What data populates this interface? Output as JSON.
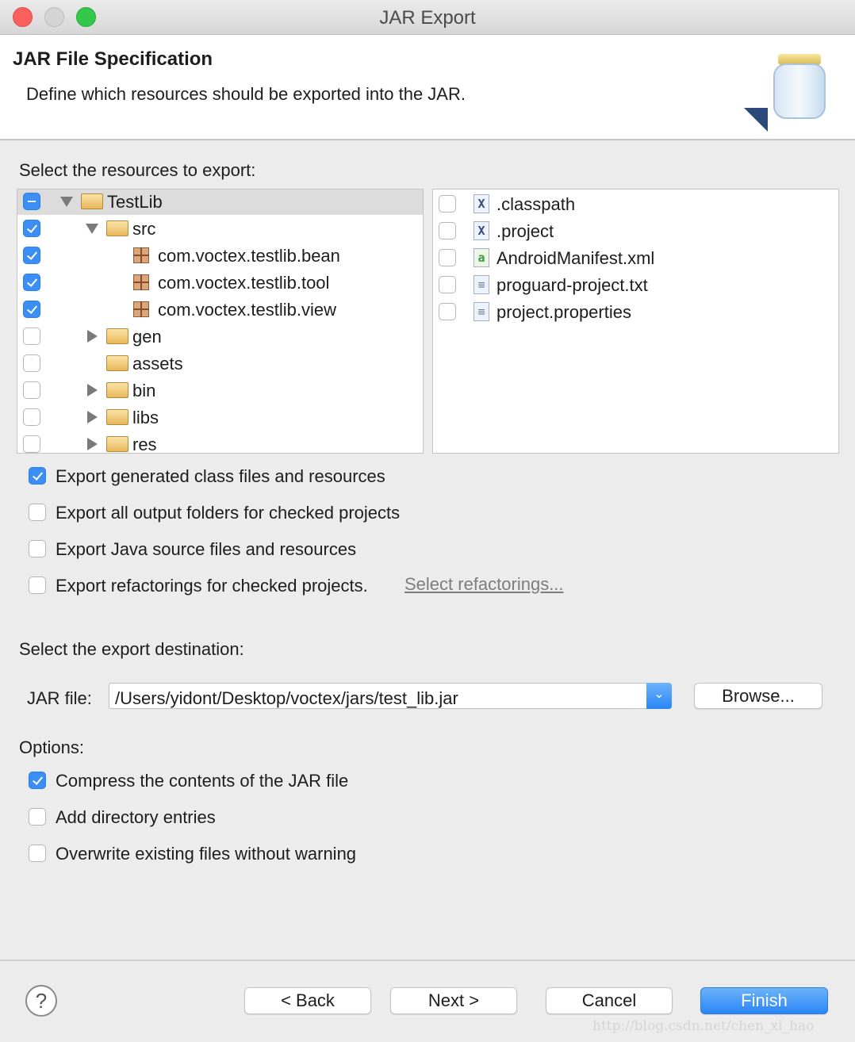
{
  "window": {
    "title": "JAR Export"
  },
  "header": {
    "title": "JAR File Specification",
    "description": "Define which resources should be exported into the JAR."
  },
  "resources": {
    "label": "Select the resources to export:",
    "tree": [
      {
        "label": "TestLib",
        "state": "mixed",
        "expander": "down",
        "icon": "project-folder-icon",
        "level": 0
      },
      {
        "label": "src",
        "state": "checked",
        "expander": "down",
        "icon": "source-folder-icon",
        "level": 1
      },
      {
        "label": "com.voctex.testlib.bean",
        "state": "checked",
        "expander": "",
        "icon": "package-icon",
        "level": 2
      },
      {
        "label": "com.voctex.testlib.tool",
        "state": "checked",
        "expander": "",
        "icon": "package-icon",
        "level": 2
      },
      {
        "label": "com.voctex.testlib.view",
        "state": "checked",
        "expander": "",
        "icon": "package-icon",
        "level": 2
      },
      {
        "label": "gen",
        "state": "unchecked",
        "expander": "right",
        "icon": "source-folder-icon",
        "level": 1
      },
      {
        "label": "assets",
        "state": "unchecked",
        "expander": "",
        "icon": "folder-icon",
        "level": 1
      },
      {
        "label": "bin",
        "state": "unchecked",
        "expander": "right",
        "icon": "folder-icon",
        "level": 1
      },
      {
        "label": "libs",
        "state": "unchecked",
        "expander": "right",
        "icon": "folder-icon",
        "level": 1
      },
      {
        "label": "res",
        "state": "unchecked",
        "expander": "right",
        "icon": "folder-icon",
        "level": 1
      }
    ],
    "files": [
      {
        "label": ".classpath",
        "checked": false,
        "icon": "xml-file-icon"
      },
      {
        "label": ".project",
        "checked": false,
        "icon": "xml-file-icon"
      },
      {
        "label": "AndroidManifest.xml",
        "checked": false,
        "icon": "android-manifest-icon"
      },
      {
        "label": "proguard-project.txt",
        "checked": false,
        "icon": "text-file-icon"
      },
      {
        "label": "project.properties",
        "checked": false,
        "icon": "text-file-icon"
      }
    ]
  },
  "export_options": [
    {
      "label": "Export generated class files and resources",
      "checked": true
    },
    {
      "label": "Export all output folders for checked projects",
      "checked": false
    },
    {
      "label": "Export Java source files and resources",
      "checked": false
    },
    {
      "label": "Export refactorings for checked projects.",
      "checked": false
    }
  ],
  "select_refactorings_link": "Select refactorings...",
  "destination": {
    "label": "Select the export destination:",
    "jar_label": "JAR file:",
    "jar_value": "/Users/yidont/Desktop/voctex/jars/test_lib.jar",
    "browse": "Browse..."
  },
  "options": {
    "label": "Options:",
    "items": [
      {
        "label": "Compress the contents of the JAR file",
        "checked": true
      },
      {
        "label": "Add directory entries",
        "checked": false
      },
      {
        "label": "Overwrite existing files without warning",
        "checked": false
      }
    ]
  },
  "buttons": {
    "help": "?",
    "back": "< Back",
    "next": "Next >",
    "cancel": "Cancel",
    "finish": "Finish"
  },
  "watermark": "http://blog.csdn.net/chen_xi_hao",
  "colors": {
    "accent": "#3a8ef6",
    "close": "#fc605c",
    "minimize": "#d4d4d4",
    "zoom": "#34c84a"
  }
}
